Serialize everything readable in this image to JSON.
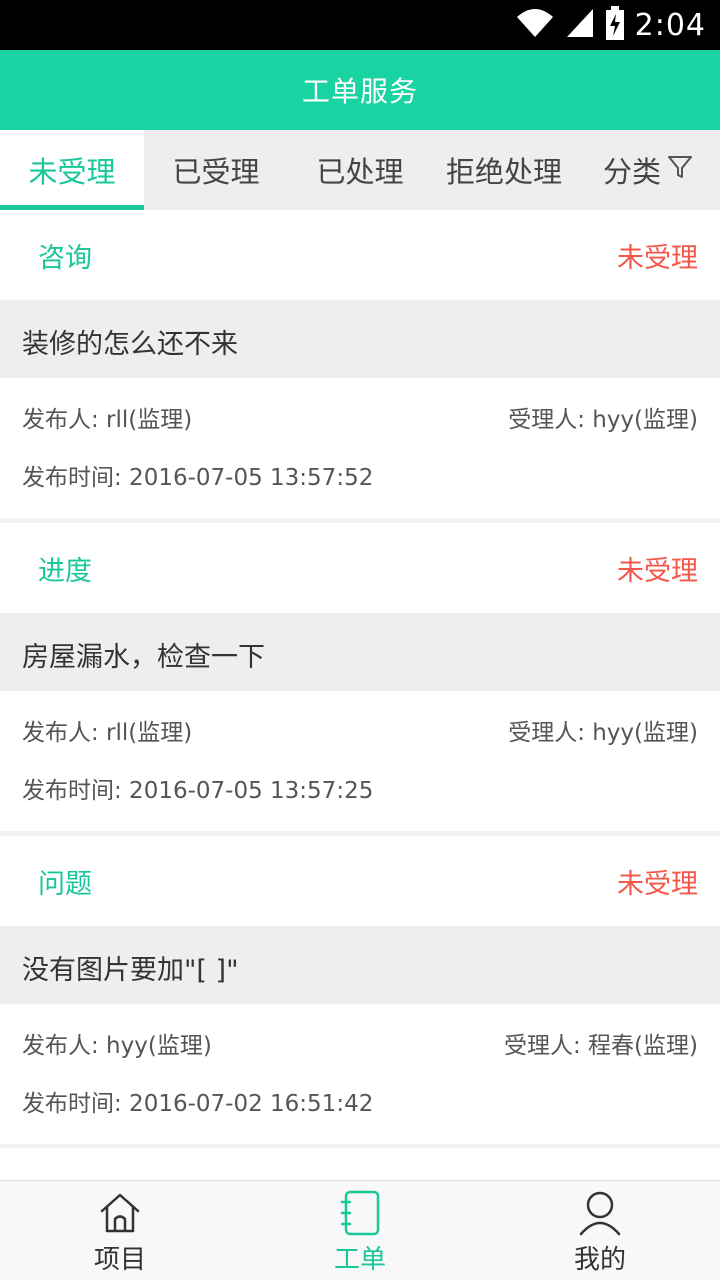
{
  "status_bar": {
    "time": "2:04",
    "icons": [
      "wifi-icon",
      "cell-signal-icon",
      "battery-charging-icon"
    ]
  },
  "header": {
    "title": "工单服务"
  },
  "tabs": [
    {
      "label": "未受理",
      "active": true
    },
    {
      "label": "已受理",
      "active": false
    },
    {
      "label": "已处理",
      "active": false
    },
    {
      "label": "拒绝处理",
      "active": false
    },
    {
      "label": "分类",
      "active": false,
      "icon": "filter-icon"
    }
  ],
  "tickets": [
    {
      "category": "咨询",
      "status": "未受理",
      "title": "装修的怎么还不来",
      "publisher": "发布人: rll(监理)",
      "handler": "受理人: hyy(监理)",
      "time": "发布时间: 2016-07-05 13:57:52"
    },
    {
      "category": "进度",
      "status": "未受理",
      "title": "房屋漏水，检查一下",
      "publisher": "发布人: rll(监理)",
      "handler": "受理人: hyy(监理)",
      "time": "发布时间: 2016-07-05 13:57:25"
    },
    {
      "category": "问题",
      "status": "未受理",
      "title": "没有图片要加\"[ ]\"",
      "publisher": "发布人: hyy(监理)",
      "handler": "受理人: 程春(监理)",
      "time": "发布时间: 2016-07-02 16:51:42"
    }
  ],
  "bottom_nav": [
    {
      "label": "项目",
      "icon": "home-icon",
      "active": false
    },
    {
      "label": "工单",
      "icon": "notebook-icon",
      "active": true
    },
    {
      "label": "我的",
      "icon": "user-icon",
      "active": false
    }
  ],
  "colors": {
    "accent": "#19d3a2",
    "accent_text": "#19c79a",
    "status_red": "#f4574a",
    "tab_bg": "#eeeeee"
  }
}
